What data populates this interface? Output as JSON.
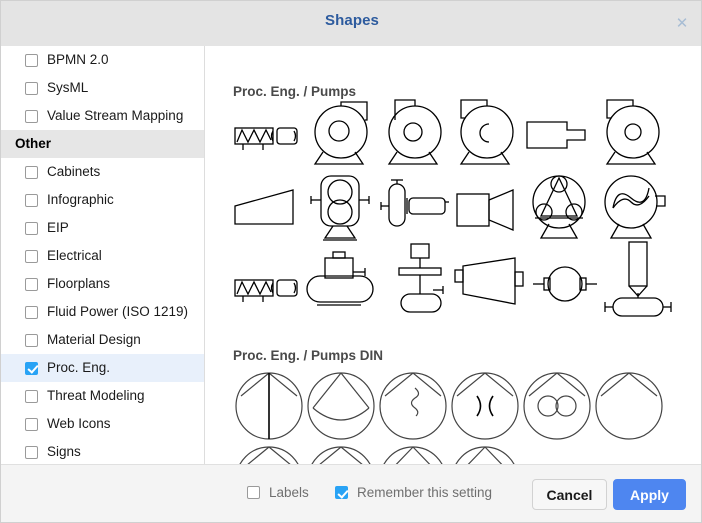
{
  "dialog": {
    "title": "Shapes",
    "close_icon": "close-icon"
  },
  "sidebar": {
    "items": [
      {
        "label": "BPMN 2.0",
        "type": "checkbox",
        "checked": false,
        "selected": false
      },
      {
        "label": "SysML",
        "type": "checkbox",
        "checked": false,
        "selected": false
      },
      {
        "label": "Value Stream Mapping",
        "type": "checkbox",
        "checked": false,
        "selected": false
      },
      {
        "label": "Other",
        "type": "group",
        "checked": false,
        "selected": false
      },
      {
        "label": "Cabinets",
        "type": "checkbox",
        "checked": false,
        "selected": false
      },
      {
        "label": "Infographic",
        "type": "checkbox",
        "checked": false,
        "selected": false
      },
      {
        "label": "EIP",
        "type": "checkbox",
        "checked": false,
        "selected": false
      },
      {
        "label": "Electrical",
        "type": "checkbox",
        "checked": false,
        "selected": false
      },
      {
        "label": "Floorplans",
        "type": "checkbox",
        "checked": false,
        "selected": false
      },
      {
        "label": "Fluid Power (ISO 1219)",
        "type": "checkbox",
        "checked": false,
        "selected": false
      },
      {
        "label": "Material Design",
        "type": "checkbox",
        "checked": false,
        "selected": false
      },
      {
        "label": "Proc. Eng.",
        "type": "checkbox",
        "checked": true,
        "selected": true
      },
      {
        "label": "Threat Modeling",
        "type": "checkbox",
        "checked": false,
        "selected": false
      },
      {
        "label": "Web Icons",
        "type": "checkbox",
        "checked": false,
        "selected": false
      },
      {
        "label": "Signs",
        "type": "checkbox",
        "checked": false,
        "selected": false
      }
    ]
  },
  "shape_panel": {
    "sections": [
      {
        "title": "Proc. Eng. / Pumps",
        "shapes": [
          "screw-pump-icon",
          "centrifugal-pump-icon",
          "centrifugal-pump-alt-icon",
          "centrifugal-pump-c-icon",
          "nozzle-icon",
          "centrifugal-pump-small-icon",
          "wedge-pump-icon",
          "twin-circle-pump-icon",
          "vertical-pump-tank-icon",
          "ejector-icon",
          "three-roller-pump-icon",
          "s-rotor-pump-icon",
          "screw-pump-2-icon",
          "dome-tank-pump-icon",
          "vertical-sealed-pump-icon",
          "cone-pump-icon",
          "circle-port-pump-icon",
          "column-tank-pump-icon"
        ]
      },
      {
        "title": "Proc. Eng. / Pumps DIN",
        "shapes": [
          "din-pump-line-icon",
          "din-pump-arc-icon",
          "din-pump-wave-icon",
          "din-pump-brackets-icon",
          "din-pump-twin-circle-icon",
          "din-pump-plain-icon",
          "din-pump-row2-a-icon",
          "din-pump-row2-b-icon",
          "din-pump-row2-c-icon",
          "din-pump-row2-d-icon"
        ]
      }
    ]
  },
  "footer": {
    "labels_checkbox": {
      "label": "Labels",
      "checked": false
    },
    "remember_checkbox": {
      "label": "Remember this setting",
      "checked": true
    },
    "cancel_label": "Cancel",
    "apply_label": "Apply"
  },
  "colors": {
    "accent": "#4e86f0",
    "checkbox_on": "#29a3f5",
    "title": "#2d5b9e",
    "selected_row": "#e8f0fb"
  }
}
